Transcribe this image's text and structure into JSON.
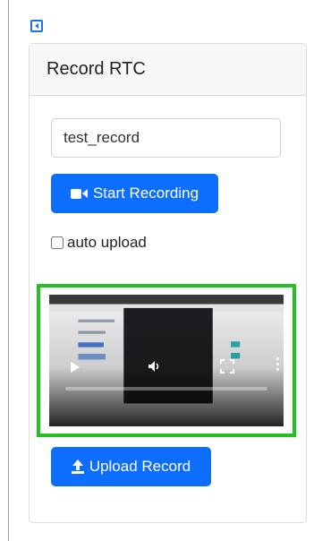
{
  "card": {
    "title": "Record RTC"
  },
  "record_name": {
    "value": "test_record"
  },
  "start_button": {
    "label": "Start Recording"
  },
  "auto_upload": {
    "label": "auto upload",
    "checked": false
  },
  "upload_button": {
    "label": "Upload Record"
  },
  "colors": {
    "primary": "#0d6efd",
    "video_border": "#24c024"
  },
  "icons": {
    "back": "back-arrow-icon",
    "video": "video-camera-icon",
    "upload": "upload-icon"
  }
}
